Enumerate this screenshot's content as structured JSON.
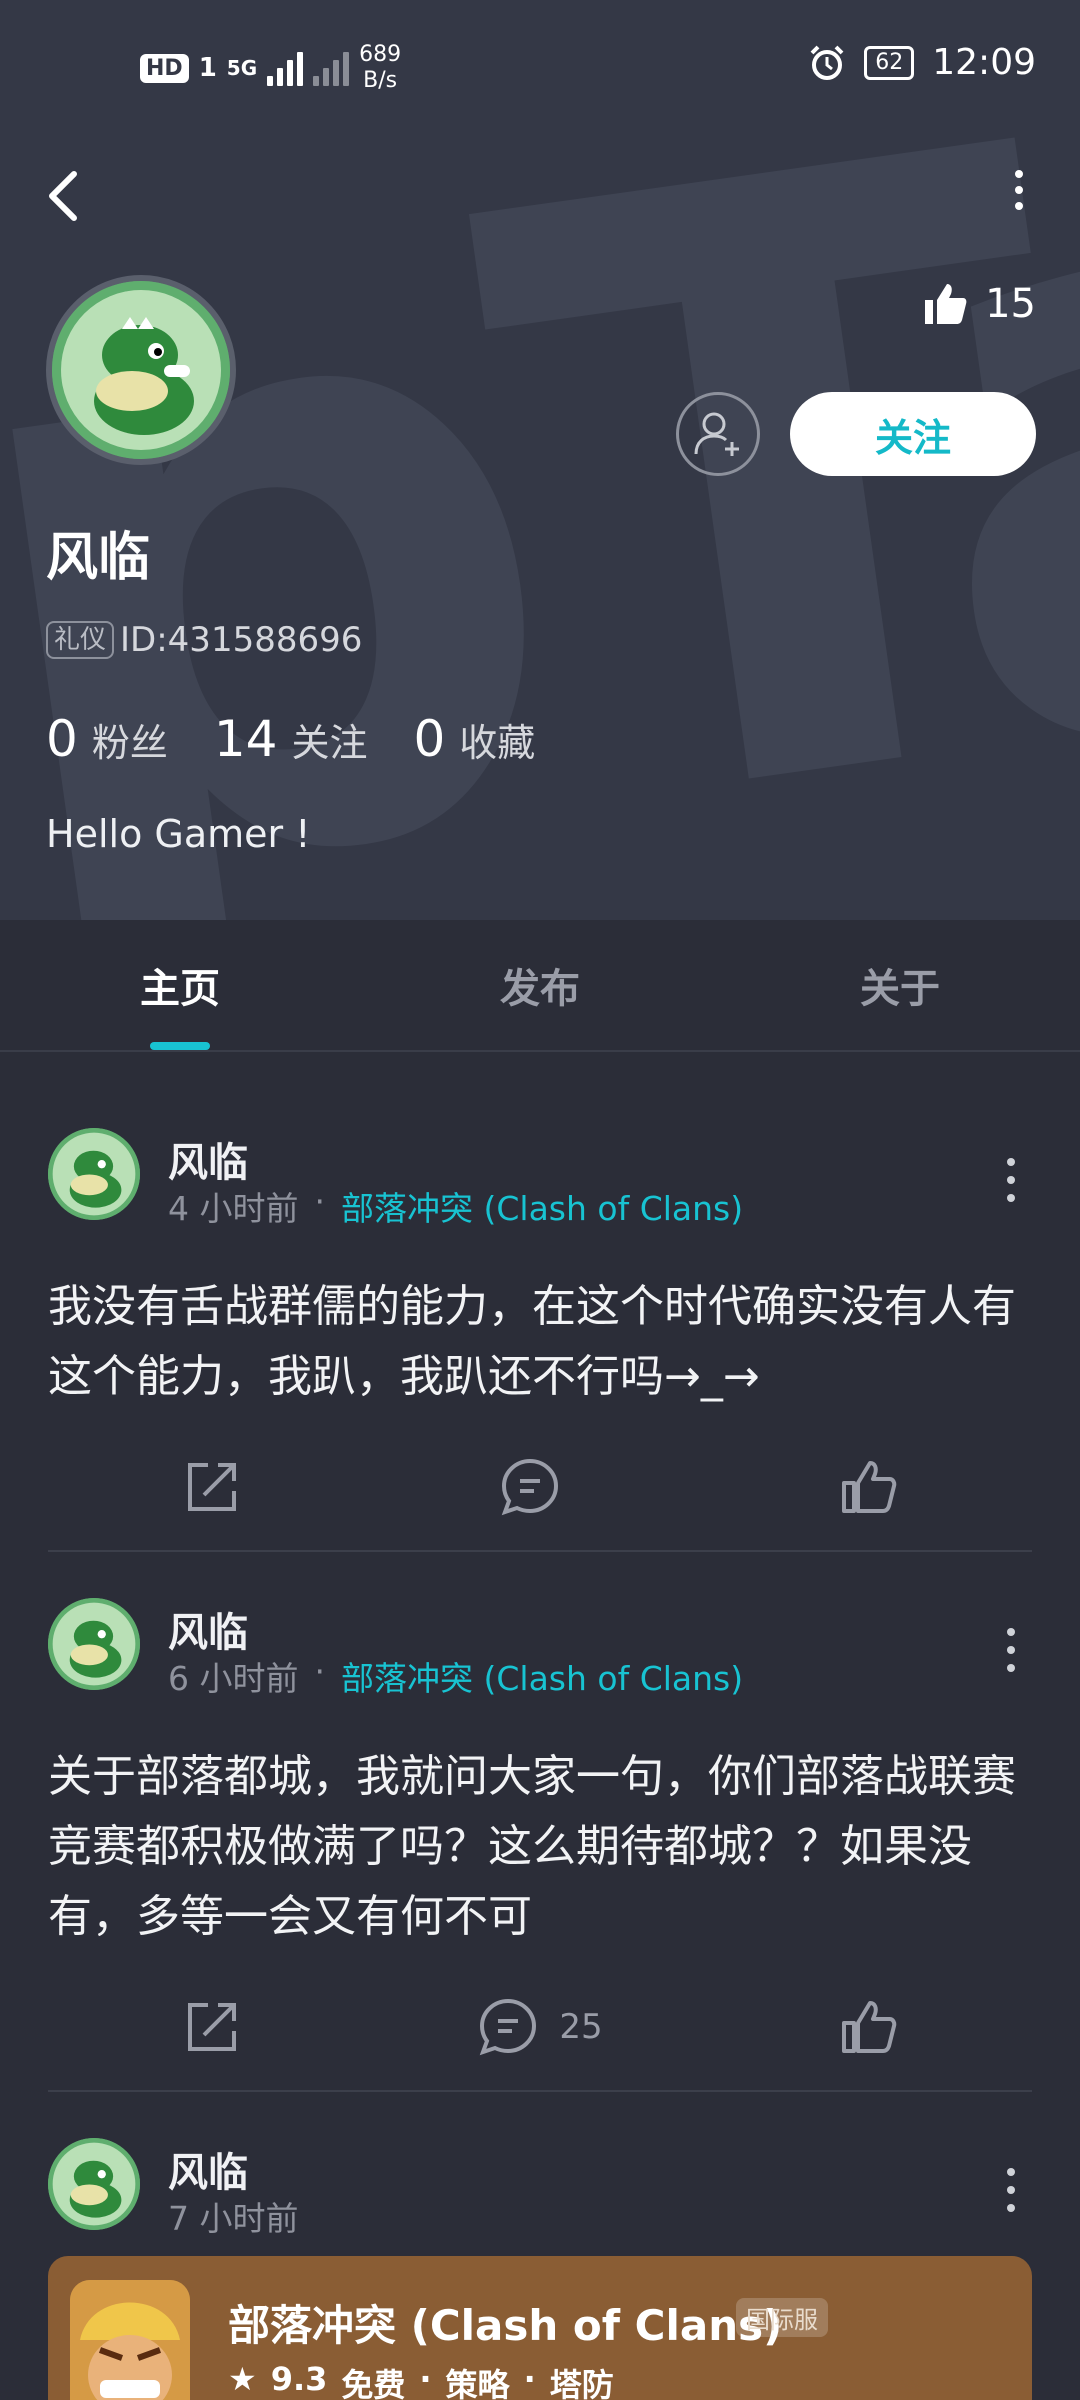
{
  "statusbar": {
    "hd": "HD",
    "sim": "1",
    "net": "5G",
    "speed_value": "689",
    "speed_unit": "B/s",
    "battery": "62",
    "time": "12:09"
  },
  "profile": {
    "like_count": "15",
    "follow_label": "关注",
    "nickname": "风临",
    "id_tag": "礼仪",
    "id_text": "ID:431588696",
    "stats": [
      {
        "num": "0",
        "label": "粉丝"
      },
      {
        "num": "14",
        "label": "关注"
      },
      {
        "num": "0",
        "label": "收藏"
      }
    ],
    "bio": "Hello Gamer !"
  },
  "tabs": [
    {
      "label": "主页",
      "active": true
    },
    {
      "label": "发布",
      "active": false
    },
    {
      "label": "关于",
      "active": false
    }
  ],
  "posts": [
    {
      "author": "风临",
      "time": "4 小时前",
      "dot": "·",
      "game": "部落冲突 (Clash of Clans)",
      "text": "我没有舌战群儒的能力，在这个时代确实没有人有这个能力，我趴，我趴还不行吗→_→",
      "comment_count": ""
    },
    {
      "author": "风临",
      "time": "6 小时前",
      "dot": "·",
      "game": "部落冲突 (Clash of Clans)",
      "text": "关于部落都城，我就问大家一句，你们部落战联赛竞赛都积极做满了吗？这么期待都城？？如果没有，多等一会又有何不可",
      "comment_count": "25"
    },
    {
      "author": "风临",
      "time": "7 小时前"
    }
  ],
  "game_card": {
    "name": "部落冲突 (Clash of Clans)",
    "tag": "国际服",
    "rating": "9.3",
    "price": "免费",
    "genre1": "策略",
    "genre2": "塔防",
    "sep": "·"
  },
  "colors": {
    "accent": "#18c3d2",
    "background": "#2b2d38",
    "hero": "#343846",
    "card": "#8a5d34"
  }
}
